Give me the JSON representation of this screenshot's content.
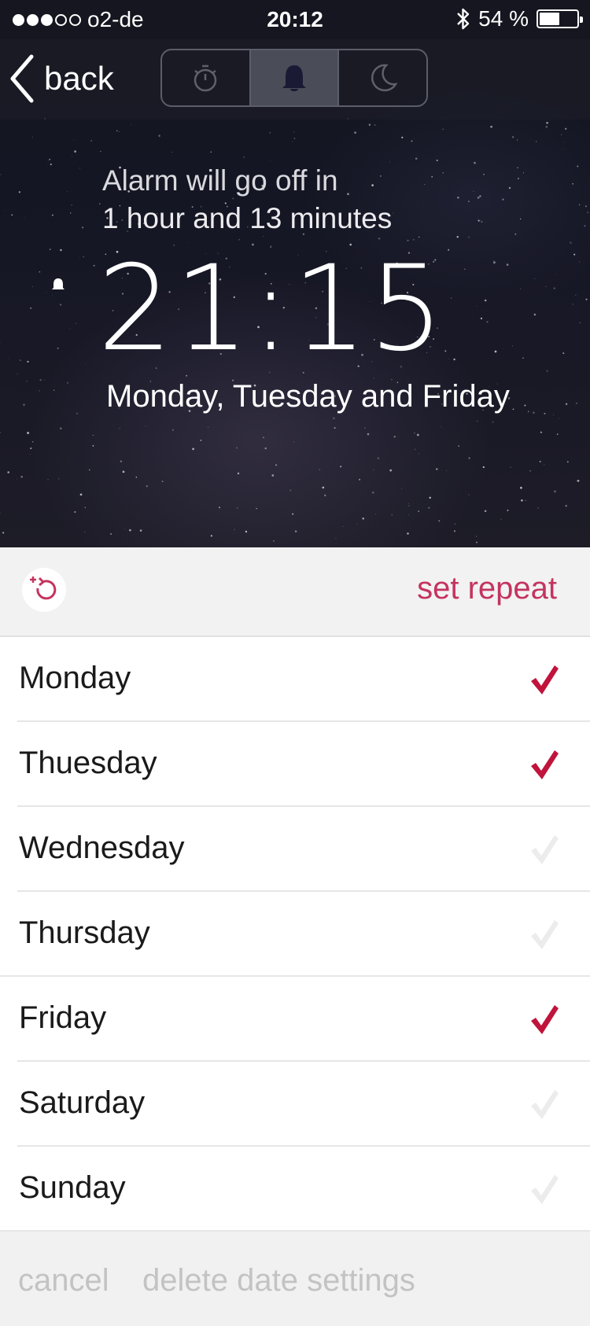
{
  "status_bar": {
    "signal_bars": 3,
    "signal_total": 5,
    "carrier": "o2-de",
    "time": "20:12",
    "bluetooth_icon": "bluetooth-icon",
    "battery_percent_label": "54 %",
    "battery_level": 0.54
  },
  "nav": {
    "back_label": "back",
    "segments": [
      {
        "icon": "stopwatch-icon",
        "active": false
      },
      {
        "icon": "bell-icon",
        "active": true
      },
      {
        "icon": "moon-icon",
        "active": false
      }
    ]
  },
  "alarm": {
    "countdown_line1": "Alarm will go off in",
    "countdown_line2": "1 hour and 13 minutes",
    "time": "21:15",
    "days_summary": "Monday, Tuesday and Friday"
  },
  "repeat": {
    "icon": "repeat-add-icon",
    "label": "set repeat"
  },
  "days": [
    {
      "label": "Monday",
      "checked": true
    },
    {
      "label": "Thuesday",
      "checked": true
    },
    {
      "label": "Wednesday",
      "checked": false
    },
    {
      "label": "Thursday",
      "checked": false
    },
    {
      "label": "Friday",
      "checked": true
    },
    {
      "label": "Saturday",
      "checked": false
    },
    {
      "label": "Sunday",
      "checked": false
    }
  ],
  "footer": {
    "cancel_label": "cancel",
    "delete_label": "delete date settings"
  },
  "colors": {
    "accent": "#c4345f",
    "check_on": "#c0143c",
    "check_off": "#ececec"
  }
}
